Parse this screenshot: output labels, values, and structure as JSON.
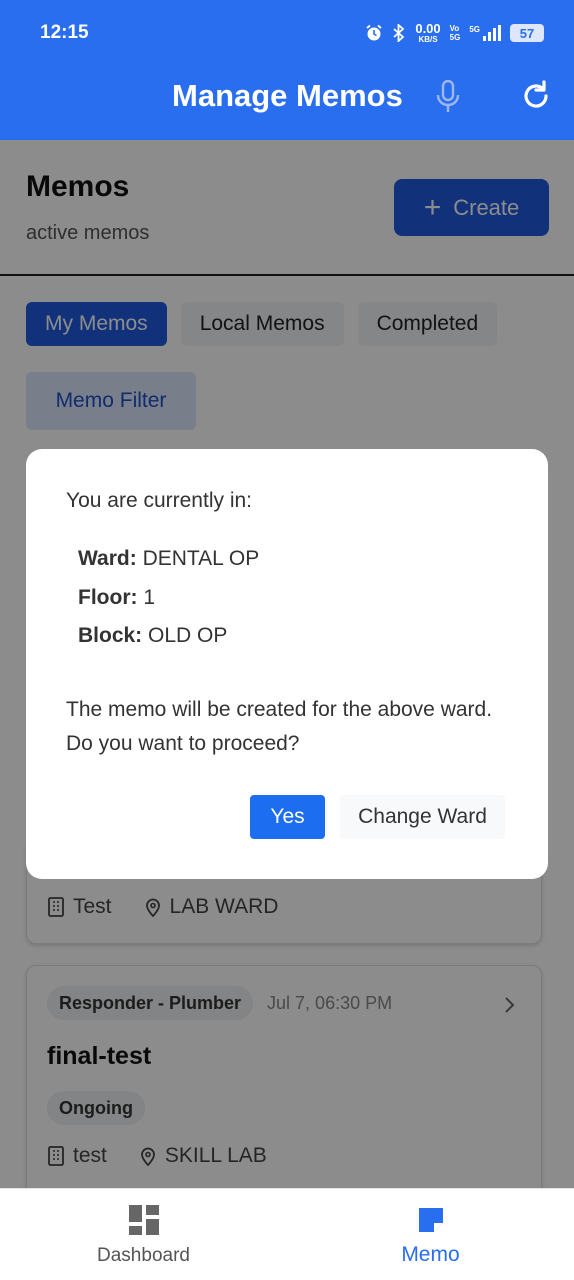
{
  "status_bar": {
    "time": "12:15",
    "net_speed_top": "0.00",
    "net_speed_unit": "KB/S",
    "volte_top": "Vo",
    "volte_bottom": "5G",
    "network": "5G",
    "battery": "57"
  },
  "appbar": {
    "title": "Manage Memos",
    "icons": [
      "microphone-icon",
      "refresh-icon"
    ]
  },
  "header": {
    "title": "Memos",
    "subtitle": "active memos",
    "create_label": "Create"
  },
  "tabs": [
    {
      "label": "My Memos",
      "active": true
    },
    {
      "label": "Local Memos",
      "active": false
    },
    {
      "label": "Completed",
      "active": false
    }
  ],
  "filter_label": "Memo Filter",
  "cards": [
    {
      "building": "Test",
      "location": "LAB WARD"
    },
    {
      "responder": "Responder - Plumber",
      "time": "Jul 7, 06:30 PM",
      "title": "final-test",
      "status": "Ongoing",
      "building": "test",
      "location": "SKILL LAB"
    }
  ],
  "dialog": {
    "intro": "You are currently in:",
    "ward_label": "Ward:",
    "ward_value": "DENTAL OP",
    "floor_label": "Floor:",
    "floor_value": "1",
    "block_label": "Block:",
    "block_value": "OLD OP",
    "message": "The memo will be created for the above ward. Do you want to proceed?",
    "yes_label": "Yes",
    "change_label": "Change Ward"
  },
  "bottom_nav": [
    {
      "label": "Dashboard",
      "icon": "dashboard-icon",
      "active": false
    },
    {
      "label": "Memo",
      "icon": "memo-icon",
      "active": true
    }
  ],
  "colors": {
    "primary": "#2a6ef0",
    "button_blue": "#1c6df0",
    "overlay": "rgba(0,0,0,0.45)"
  }
}
